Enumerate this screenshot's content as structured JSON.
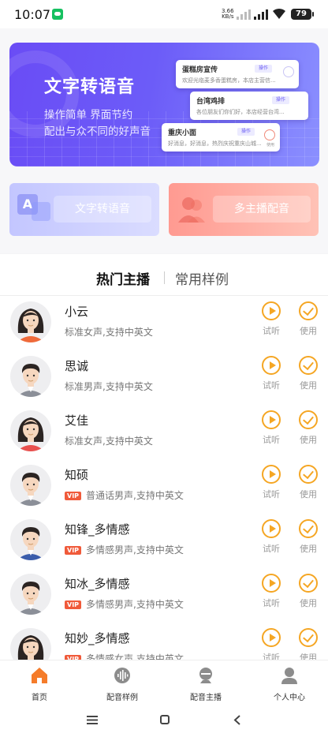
{
  "status_bar": {
    "time": "10:07",
    "net_speed_value": "3.66",
    "net_speed_unit": "KB/s",
    "battery": "79"
  },
  "banner": {
    "title": "文字转语音",
    "subtitle_line1": "操作简单 界面节约",
    "subtitle_line2": "配出与众不同的好声音",
    "cards": [
      {
        "title": "蛋糕房宣传",
        "tag": "操作",
        "text": "欢迎光临麦多香蛋糕房，本店主营信..."
      },
      {
        "title": "台湾鸡排",
        "tag": "操作",
        "text": "各位朋友们你们好，本店经营台湾..."
      },
      {
        "title": "重庆小面",
        "tag": "操作",
        "text": "好消息，好消息，热烈庆祝重庆山城...",
        "check_label": "使用"
      }
    ]
  },
  "features": {
    "tts_label": "文字转语音",
    "multi_label": "多主播配音"
  },
  "tabs": {
    "hot": "热门主播",
    "common": "常用样例"
  },
  "actions": {
    "listen": "试听",
    "use": "使用"
  },
  "anchors": [
    {
      "name": "小云",
      "desc": "标准女声,支持中英文",
      "vip": false,
      "gender": "female"
    },
    {
      "name": "思诚",
      "desc": "标准男声,支持中英文",
      "vip": false,
      "gender": "male"
    },
    {
      "name": "艾佳",
      "desc": "标准女声,支持中英文",
      "vip": false,
      "gender": "female"
    },
    {
      "name": "知硕",
      "desc": "普通话男声,支持中英文",
      "vip": true,
      "gender": "male"
    },
    {
      "name": "知锋_多情感",
      "desc": "多情感男声,支持中英文",
      "vip": true,
      "gender": "male"
    },
    {
      "name": "知冰_多情感",
      "desc": "多情感男声,支持中英文",
      "vip": true,
      "gender": "male"
    },
    {
      "name": "知妙_多情感",
      "desc": "多情感女声,支持中英文",
      "vip": true,
      "gender": "female"
    }
  ],
  "vip_label": "VIP",
  "bottom_nav": [
    {
      "label": "首页",
      "icon": "home-icon",
      "active": true
    },
    {
      "label": "配音样例",
      "icon": "waveform-icon",
      "active": false
    },
    {
      "label": "配音主播",
      "icon": "anchor-icon",
      "active": false
    },
    {
      "label": "个人中心",
      "icon": "profile-icon",
      "active": false
    }
  ],
  "colors": {
    "accent": "#f5a623",
    "vip": "#f05a3a",
    "home_active": "#f57c2a",
    "banner": "#6a4cf5"
  }
}
